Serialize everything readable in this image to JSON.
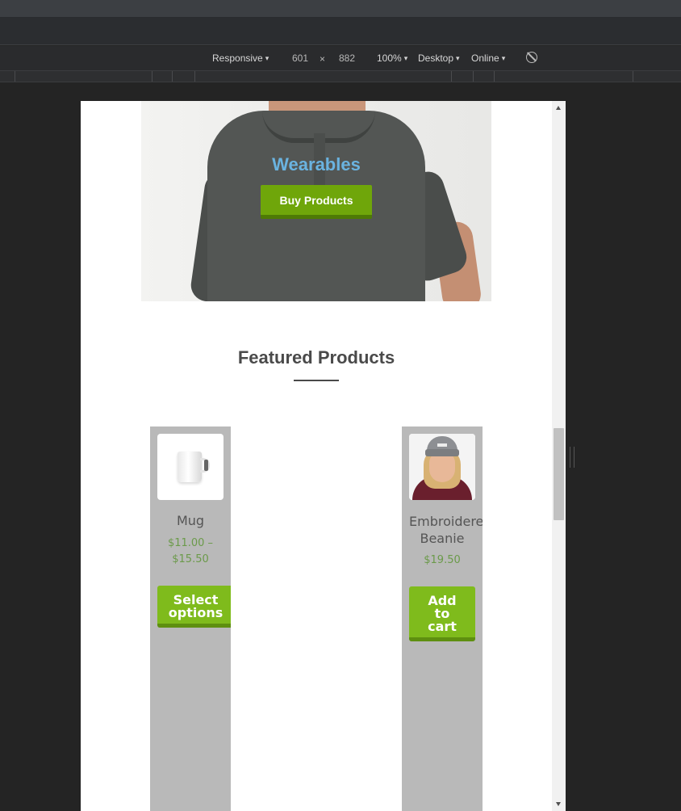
{
  "devtools": {
    "device_label": "Responsive",
    "width_value": "601",
    "times_symbol": "×",
    "height_value": "882",
    "zoom_label": "100%",
    "mode_label": "Desktop",
    "network_label": "Online",
    "caret": "▾"
  },
  "page": {
    "hero": {
      "title": "Wearables",
      "button_label": "Buy Products"
    },
    "featured": {
      "title": "Featured Products",
      "products": [
        {
          "name": "Mug",
          "price_line1": "$11.00 –",
          "price_line2": "$15.50",
          "button_line1": "Select",
          "button_line2": "options",
          "button_line3": ""
        },
        {
          "name_line1": "Embroidered",
          "name_line2": "Beanie",
          "price": "$19.50",
          "button_line1": "Add",
          "button_line2": "to",
          "button_line3": "cart"
        }
      ]
    }
  },
  "colors": {
    "accent_green": "#7fbb1c",
    "hero_title_blue": "#6ab3e0",
    "price_green": "#6b9a4a"
  }
}
